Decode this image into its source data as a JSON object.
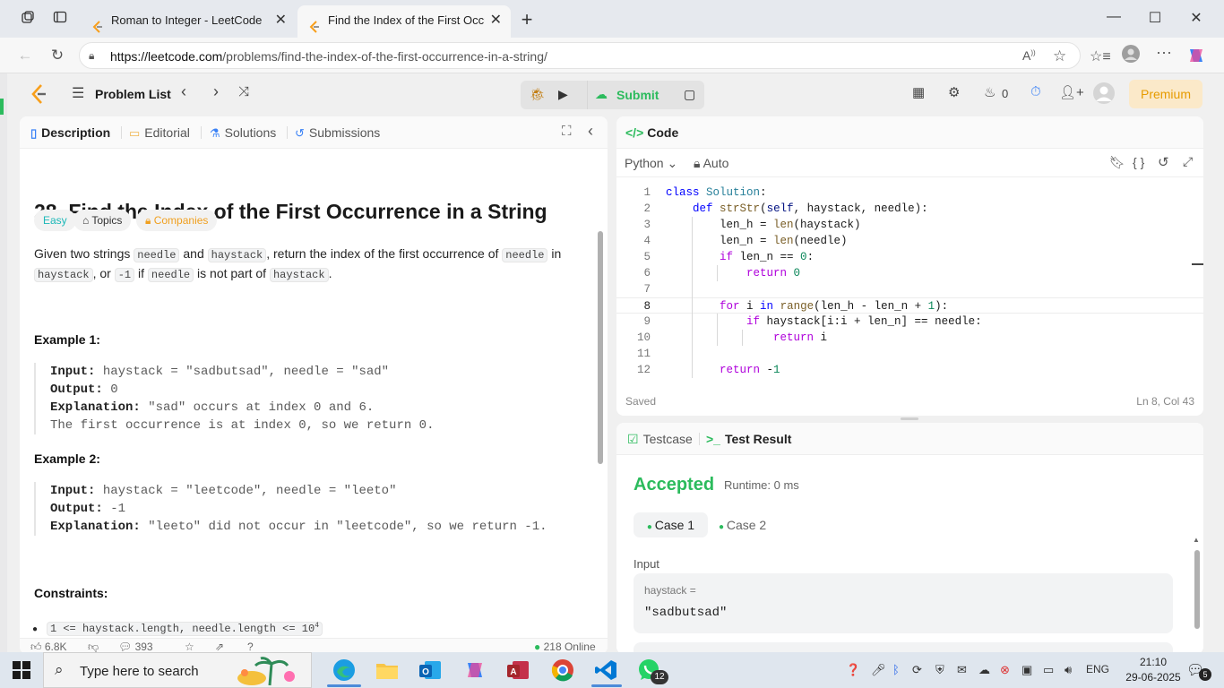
{
  "browser": {
    "tabs": [
      {
        "title": "Roman to Integer - LeetCode",
        "active": false
      },
      {
        "title": "Find the Index of the First Occurre",
        "active": true
      }
    ],
    "url_host": "https://leetcode.com",
    "url_path": "/problems/find-the-index-of-the-first-occurrence-in-a-string/"
  },
  "topbar": {
    "problem_list": "Problem List",
    "submit": "Submit",
    "streak": "0",
    "premium": "Premium"
  },
  "left_tabs": [
    "Description",
    "Editorial",
    "Solutions",
    "Submissions"
  ],
  "problem": {
    "title": "28. Find the Index of the First Occurrence in a String",
    "difficulty": "Easy",
    "topics": "Topics",
    "companies": "Companies",
    "desc_1": "Given two strings ",
    "needle": "needle",
    "and": " and ",
    "haystack": "haystack",
    "desc_2": ", return the index of the first occurrence of ",
    "in": " in",
    "or": ", or ",
    "minus_one": "-1",
    "if": " if ",
    "not_part": " is not part of ",
    "period": ".",
    "ex1_title": "Example 1:",
    "ex1_input_label": "Input:",
    "ex1_input": " haystack = \"sadbutsad\", needle = \"sad\"",
    "ex1_output_label": "Output:",
    "ex1_output": " 0",
    "ex1_expl_label": "Explanation:",
    "ex1_expl": " \"sad\" occurs at index 0 and 6.",
    "ex1_expl2": "The first occurrence is at index 0, so we return 0.",
    "ex2_title": "Example 2:",
    "ex2_input_label": "Input:",
    "ex2_input": " haystack = \"leetcode\", needle = \"leeto\"",
    "ex2_output_label": "Output:",
    "ex2_output": " -1",
    "ex2_expl_label": "Explanation:",
    "ex2_expl": " \"leeto\" did not occur in \"leetcode\", so we return -1.",
    "constraints_title": "Constraints:",
    "constraint_1": "1 <= haystack.length, needle.length <= 10",
    "constraint_1_sup": "4"
  },
  "footer_stats": {
    "likes": "6.8K",
    "comments": "393",
    "online": "218 Online"
  },
  "code": {
    "header": "Code",
    "language": "Python",
    "mode": "Auto",
    "saved": "Saved",
    "cursor": "Ln 8, Col 43",
    "line_numbers": [
      "1",
      "2",
      "3",
      "4",
      "5",
      "6",
      "7",
      "8",
      "9",
      "10",
      "11",
      "12"
    ]
  },
  "result": {
    "tab_testcase": "Testcase",
    "tab_result": "Test Result",
    "status": "Accepted",
    "runtime": "Runtime: 0 ms",
    "case1": "Case 1",
    "case2": "Case 2",
    "input_label": "Input",
    "var_label": "haystack =",
    "var_value": "\"sadbutsad\""
  },
  "taskbar": {
    "search_placeholder": "Type here to search",
    "lang": "ENG",
    "time": "21:10",
    "date": "29-06-2025",
    "notif_count": "5",
    "whatsapp_badge": "12"
  }
}
